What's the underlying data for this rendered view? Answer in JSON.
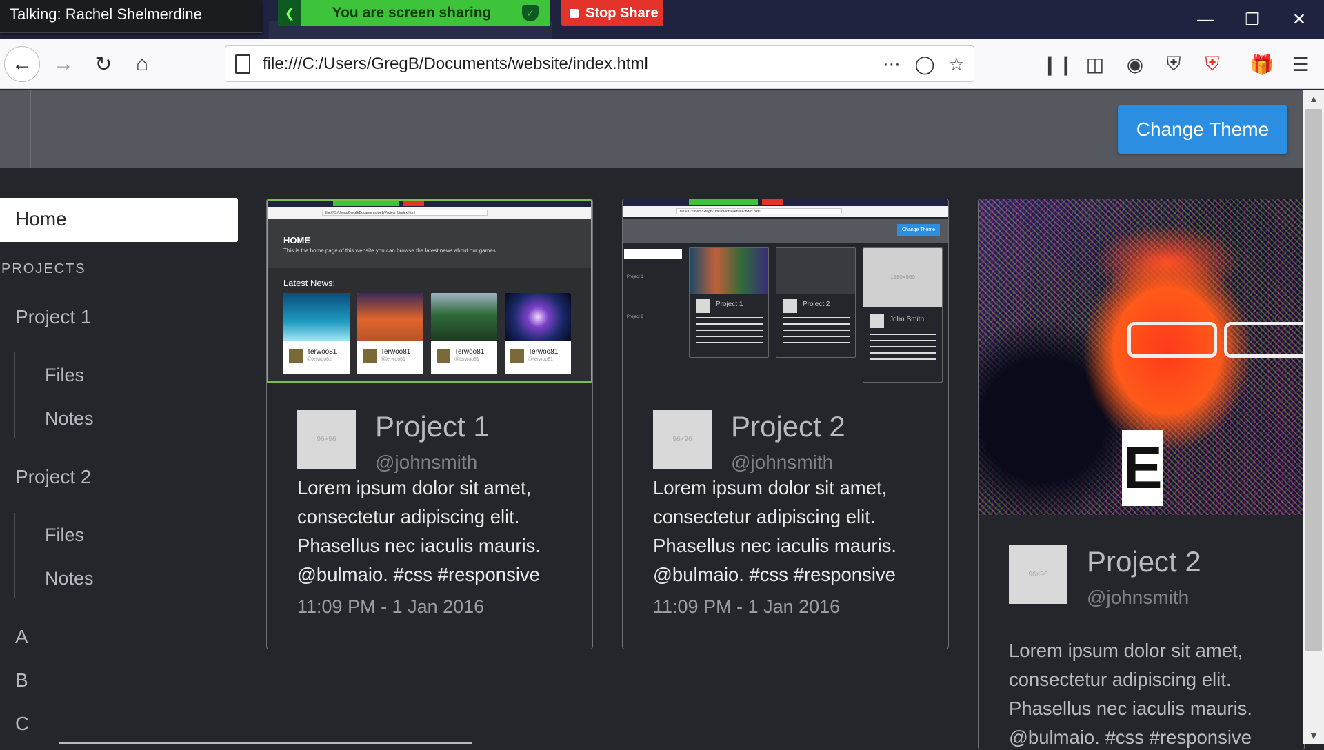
{
  "zoom_overlay": {
    "talking": "Talking: Rachel Shelmerdine",
    "sharing_status": "You are screen sharing",
    "stop_share": "Stop Share"
  },
  "browser": {
    "url": "file:///C:/Users/GregB/Documents/website/index.html",
    "window_controls": [
      "minimize",
      "restore",
      "close"
    ]
  },
  "header": {
    "change_theme": "Change Theme"
  },
  "sidebar": {
    "home": "Home",
    "section_label": "PROJECTS",
    "projects": [
      {
        "label": "Project 1",
        "children": [
          "Files",
          "Notes"
        ]
      },
      {
        "label": "Project 2",
        "children": [
          "Files",
          "Notes"
        ]
      }
    ],
    "extra": [
      "A",
      "B",
      "C"
    ]
  },
  "cards": [
    {
      "title": "Project 1",
      "handle": "@johnsmith",
      "avatar_text": "96×96",
      "body_lines": [
        "Lorem ipsum dolor sit amet,",
        "consectetur adipiscing elit.",
        "Phasellus nec iaculis mauris.",
        "@bulmaio. #css #responsive"
      ],
      "time": "11:09 PM - 1 Jan 2016",
      "thumb": {
        "heading": "HOME",
        "sub": "This is the home page of this website you can browse the latest news about our games",
        "news": "Latest News:",
        "tile_author": "Terwoo81",
        "tile_handle": "@terwoo81",
        "url": "file:///C:/Users/GregB/Documents/web/Project 2/index.html"
      }
    },
    {
      "title": "Project 2",
      "handle": "@johnsmith",
      "avatar_text": "96×96",
      "body_lines": [
        "Lorem ipsum dolor sit amet,",
        "consectetur adipiscing elit.",
        "Phasellus nec iaculis mauris.",
        "@bulmaio. #css #responsive"
      ],
      "time": "11:09 PM - 1 Jan 2016",
      "thumb": {
        "url": "file:///C:/Users/GregB/Documents/website/index.html",
        "theme": "Change Theme",
        "mini_p1": "Project 1",
        "mini_p2": "Project 2",
        "mini_john": "John Smith",
        "mini_placeholder": "1280×960"
      }
    },
    {
      "title": "Project 2",
      "handle": "@johnsmith",
      "avatar_text": "96×96",
      "body_lines": [
        "Lorem ipsum dolor sit amet,",
        "consectetur adipiscing elit.",
        "Phasellus nec iaculis mauris.",
        "@bulmaio. #css #responsive"
      ]
    }
  ],
  "colors": {
    "page_bg": "#24262b",
    "header_bg": "#55585f",
    "accent_button": "#2c8ee0",
    "share_green": "#3dc43a",
    "stop_red": "#e3332b"
  }
}
